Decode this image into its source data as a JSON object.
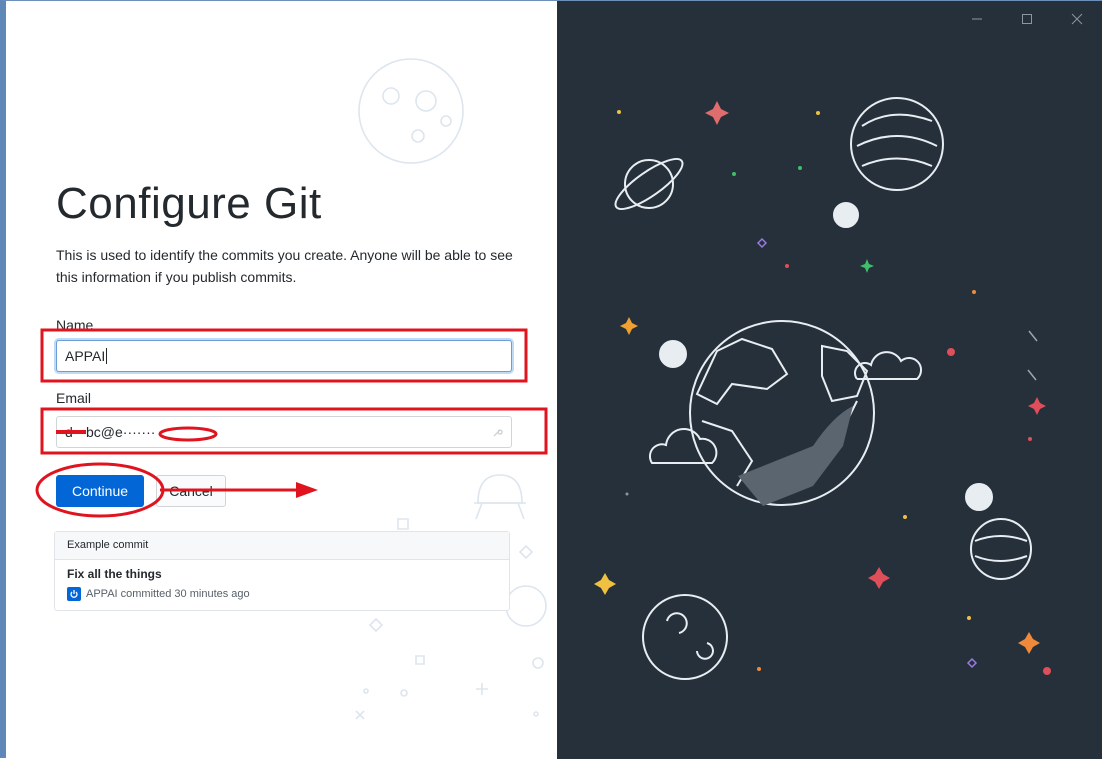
{
  "window": {
    "controls": {
      "minimize": "minimize-icon",
      "maximize": "maximize-icon",
      "close": "close-icon"
    }
  },
  "page": {
    "title": "Configure Git",
    "description": "This is used to identify the commits you create. Anyone will be able to see this information if you publish commits."
  },
  "form": {
    "name_label": "Name",
    "name_value": "APPAI",
    "email_label": "Email",
    "email_value": "d·· bc@e·······",
    "continue_label": "Continue",
    "cancel_label": "Cancel"
  },
  "example_commit": {
    "header": "Example commit",
    "summary": "Fix all the things",
    "meta": "APPAI committed 30 minutes ago"
  },
  "colors": {
    "accent": "#0366d6",
    "annotation": "#e0141e",
    "illustration_bg": "#25303a"
  }
}
